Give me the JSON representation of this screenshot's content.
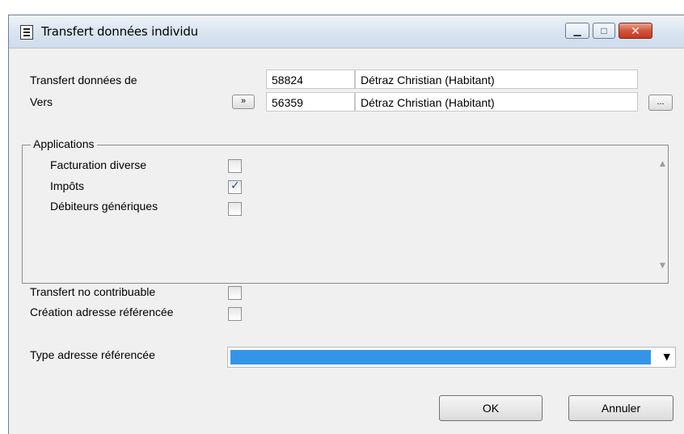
{
  "window": {
    "title": "Transfert données individu",
    "minimize_glyph": "▁",
    "maximize_glyph": "□",
    "close_glyph": "✕"
  },
  "transfer": {
    "from_label": "Transfert données de",
    "to_label": "Vers",
    "from_number": "58824",
    "from_name": "Détraz Christian (Habitant)",
    "to_number": "56359",
    "to_name": "Détraz Christian (Habitant)",
    "copy_button": "»",
    "browse_button": "..."
  },
  "applications": {
    "legend": "Applications",
    "items": [
      {
        "label": "Facturation diverse",
        "checked": false
      },
      {
        "label": "Impôts",
        "checked": true
      },
      {
        "label": "Débiteurs génériques",
        "checked": false
      }
    ]
  },
  "options": {
    "no_contribuable_label": "Transfert no contribuable",
    "no_contribuable_checked": false,
    "creation_adresse_label": "Création adresse référencée",
    "creation_adresse_checked": false
  },
  "type_adresse": {
    "label": "Type adresse référencée",
    "value": "",
    "highlight_color": "#3394ea"
  },
  "buttons": {
    "ok": "OK",
    "cancel": "Annuler"
  },
  "check_glyph": "✓"
}
